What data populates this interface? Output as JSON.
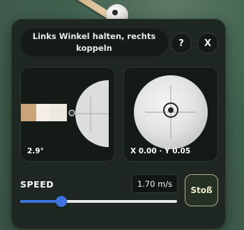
{
  "hint": {
    "text": "Links Winkel halten, rechts koppeln"
  },
  "buttons": {
    "help_label": "?",
    "close_label": "X",
    "shot_label": "Stoß"
  },
  "angle_panel": {
    "value_label": "2.9°"
  },
  "spin_panel": {
    "coords_label": "X 0.00 · Y 0.05"
  },
  "speed": {
    "label": "SPEED",
    "value_text": "1.70 m/s",
    "slider_fraction": 0.26,
    "accent_color": "#3d74e0"
  },
  "colors": {
    "panel_bg": "#1e2722",
    "card_bg": "#141b17",
    "felt": "#40604e",
    "shot_border": "#b7b28c"
  }
}
